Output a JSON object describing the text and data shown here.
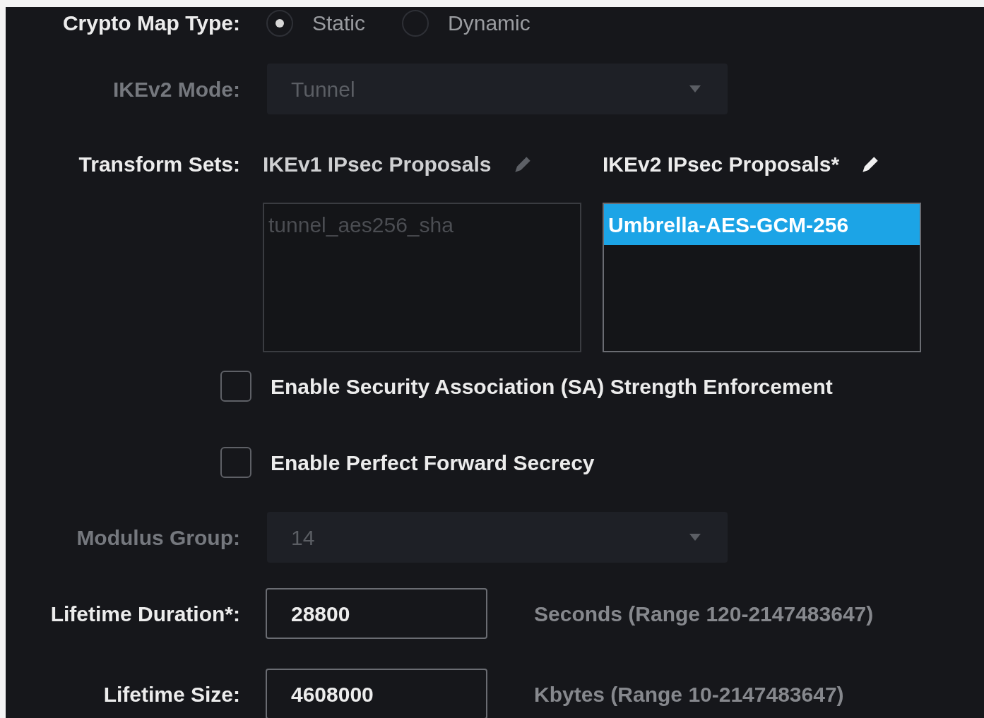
{
  "crypto_map_type": {
    "label": "Crypto Map Type:",
    "options": [
      {
        "label": "Static",
        "selected": true
      },
      {
        "label": "Dynamic",
        "selected": false
      }
    ]
  },
  "ikev2_mode": {
    "label": "IKEv2 Mode:",
    "value": "Tunnel",
    "disabled": true
  },
  "transform_sets": {
    "label": "Transform Sets:",
    "lists": [
      {
        "title": "IKEv1 IPsec Proposals",
        "disabled": true,
        "items": [
          {
            "text": "tunnel_aes256_sha",
            "selected": false
          }
        ]
      },
      {
        "title": "IKEv2 IPsec Proposals*",
        "disabled": false,
        "items": [
          {
            "text": "Umbrella-AES-GCM-256",
            "selected": true
          }
        ]
      }
    ]
  },
  "checkboxes": [
    {
      "label": "Enable Security Association (SA) Strength Enforcement",
      "checked": false
    },
    {
      "label": "Enable Perfect Forward Secrecy",
      "checked": false
    }
  ],
  "modulus_group": {
    "label": "Modulus Group:",
    "value": "14",
    "disabled": true
  },
  "lifetime": [
    {
      "label": "Lifetime Duration*:",
      "value": "28800",
      "hint": "Seconds (Range 120-2147483647)"
    },
    {
      "label": "Lifetime Size:",
      "value": "4608000",
      "hint": "Kbytes (Range 10-2147483647)"
    }
  ]
}
